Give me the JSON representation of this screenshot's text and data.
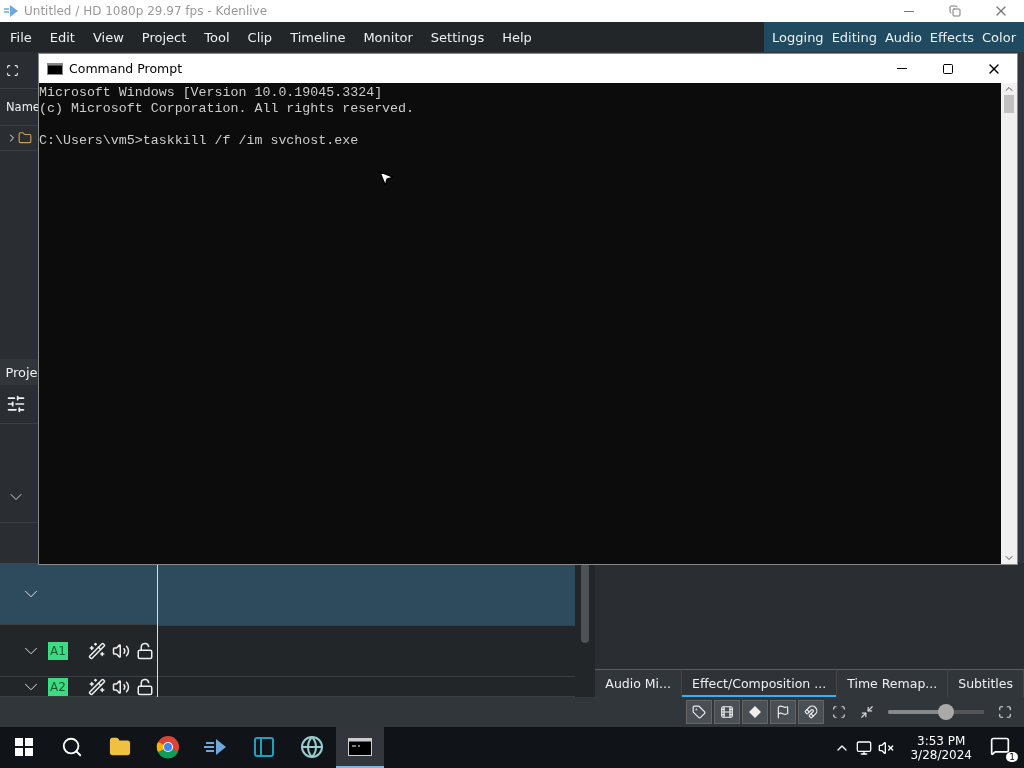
{
  "window": {
    "title": "Untitled / HD 1080p 29.97 fps - Kdenlive"
  },
  "menu": [
    "File",
    "Edit",
    "View",
    "Project",
    "Tool",
    "Clip",
    "Timeline",
    "Monitor",
    "Settings",
    "Help"
  ],
  "workspaces": [
    "Logging",
    "Editing",
    "Audio",
    "Effects",
    "Color"
  ],
  "left_panel": {
    "column_header": "Name",
    "tab": "Proje"
  },
  "console": {
    "title": "Command Prompt",
    "lines": [
      "Microsoft Windows [Version 10.0.19045.3324]",
      "(c) Microsoft Corporation. All rights reserved."
    ],
    "command": "C:\\Users\\vm5>taskkill /f /im svchost.exe"
  },
  "tracks": [
    {
      "selected": true
    },
    {
      "label": "A1",
      "selected": false
    },
    {
      "label": "A2",
      "selected": false
    }
  ],
  "panel_tabs": [
    {
      "label": "Audio Mi...",
      "selected": false
    },
    {
      "label": "Effect/Composition ...",
      "selected": true
    },
    {
      "label": "Time Remap...",
      "selected": false
    },
    {
      "label": "Subtitles",
      "selected": false
    }
  ],
  "zoom": {
    "level": 0.6
  },
  "taskbar": {
    "apps": [
      {
        "kind": "search",
        "active": false
      },
      {
        "kind": "folder",
        "active": false
      },
      {
        "kind": "browser",
        "active": false
      },
      {
        "kind": "editor",
        "active": false
      },
      {
        "kind": "panel",
        "active": false
      },
      {
        "kind": "globe",
        "active": false
      },
      {
        "kind": "console",
        "active": true
      }
    ],
    "time": "3:53 PM",
    "date": "3/28/2024",
    "notifications": "1"
  }
}
